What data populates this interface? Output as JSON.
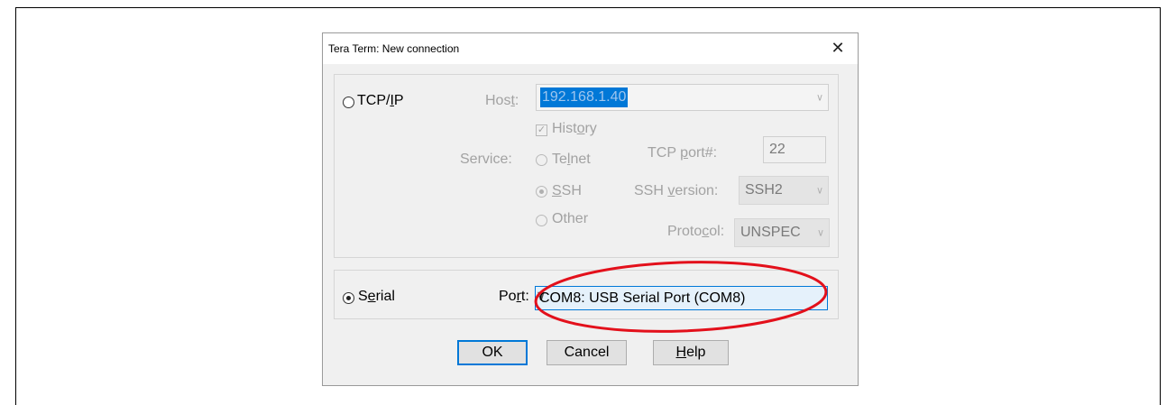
{
  "dialog": {
    "title": "Tera Term: New connection",
    "close_glyph": "✕"
  },
  "tcpip": {
    "radio_label_pre": "TCP/",
    "radio_label_ul": "I",
    "radio_label_post": "P",
    "selected": false,
    "host_label_pre": "Hos",
    "host_label_ul": "t",
    "host_label_post": ":",
    "host_value": "192.168.1.40",
    "history_label_pre": "Hist",
    "history_label_ul": "o",
    "history_label_post": "ry",
    "history_checked": true,
    "service_label": "Service:",
    "services": {
      "telnet_pre": "Te",
      "telnet_ul": "l",
      "telnet_post": "net",
      "ssh_pre": "",
      "ssh_ul": "S",
      "ssh_post": "SH",
      "other": "Other",
      "selected": "SSH"
    },
    "tcp_port_label_pre": "TCP ",
    "tcp_port_label_ul": "p",
    "tcp_port_label_post": "ort#:",
    "tcp_port_value": "22",
    "ssh_version_label_pre": "SSH ",
    "ssh_version_label_ul": "v",
    "ssh_version_label_post": "ersion:",
    "ssh_version_value": "SSH2",
    "protocol_label_pre": "Proto",
    "protocol_label_ul": "c",
    "protocol_label_post": "ol:",
    "protocol_value": "UNSPEC"
  },
  "serial": {
    "radio_label_pre": "S",
    "radio_label_ul": "e",
    "radio_label_post": "rial",
    "selected": true,
    "port_label_pre": "Po",
    "port_label_ul": "r",
    "port_label_post": "t:",
    "port_value": "COM8: USB Serial Port (COM8)"
  },
  "buttons": {
    "ok": "OK",
    "cancel": "Cancel",
    "help_ul": "H",
    "help_post": "elp"
  },
  "annotation_color": "#e3101b"
}
